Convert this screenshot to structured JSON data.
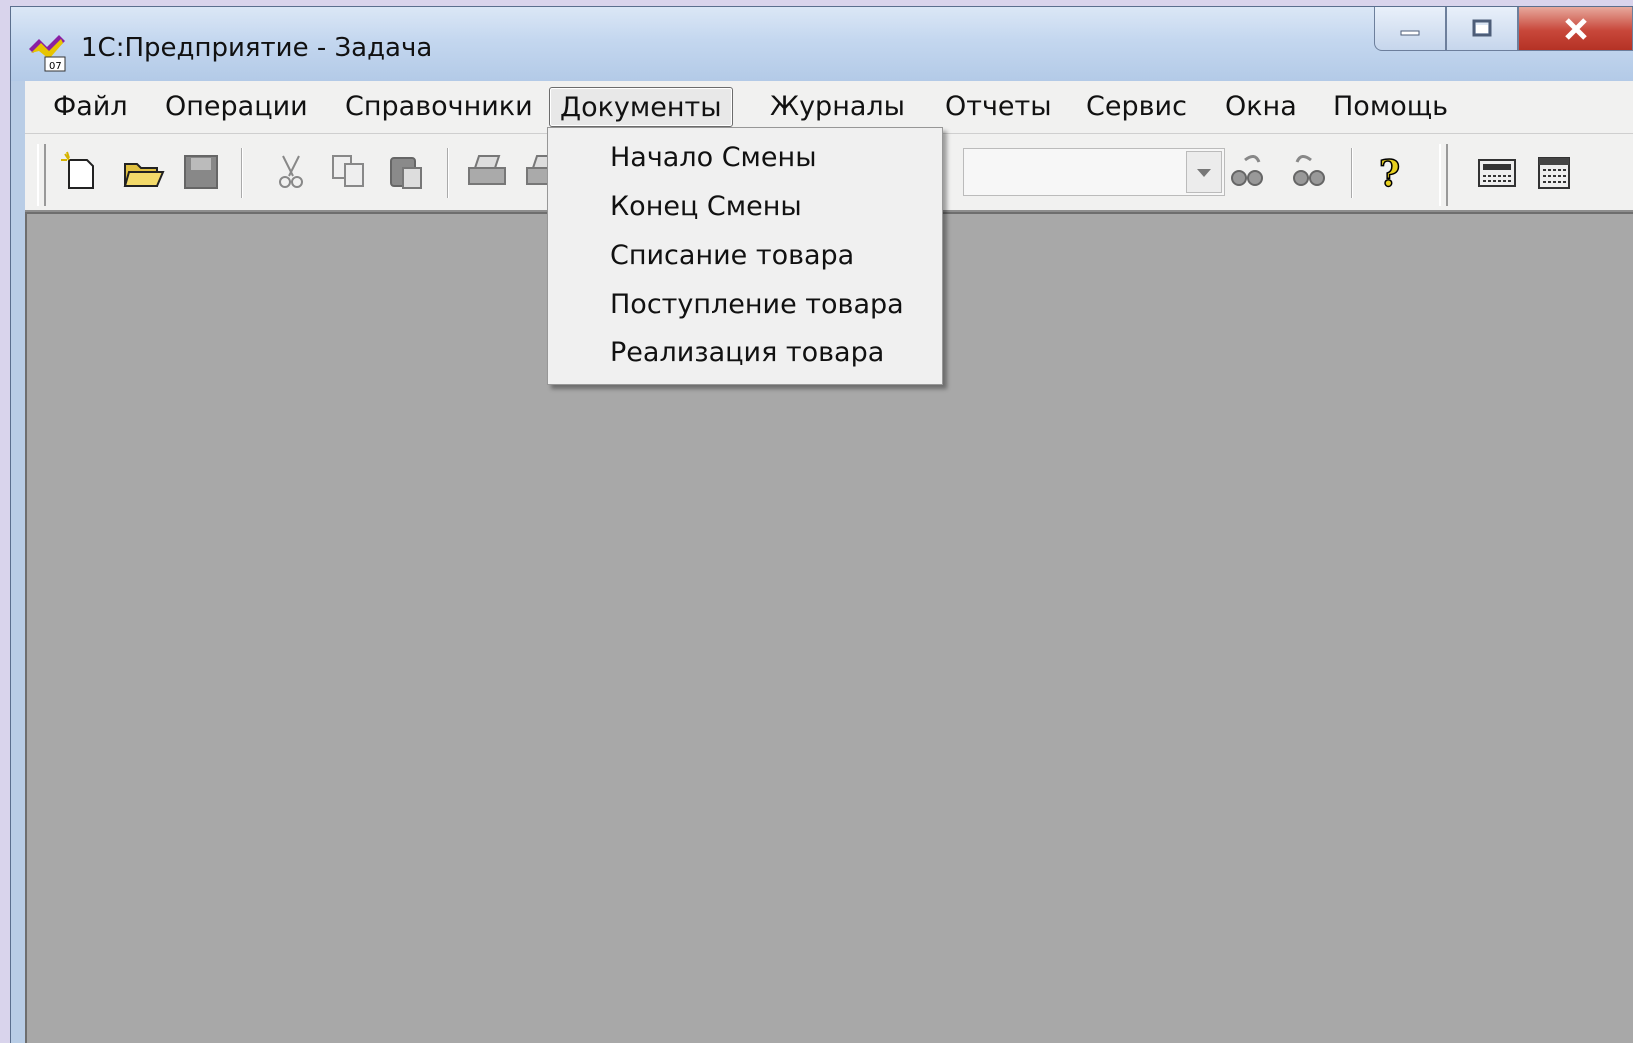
{
  "window": {
    "title": "1С:Предприятие - Задача"
  },
  "menu": {
    "items": [
      "Файл",
      "Операции",
      "Справочники",
      "Документы",
      "Журналы",
      "Отчеты",
      "Сервис",
      "Окна",
      "Помощь"
    ],
    "open_item": "Документы"
  },
  "dropdown": {
    "items": [
      "Начало Смены",
      "Конец Смены",
      "Списание товара",
      "Поступление товара",
      "Реализация товара"
    ]
  },
  "toolbar": {
    "icons": [
      "new-document-icon",
      "open-folder-icon",
      "save-icon",
      "cut-icon",
      "copy-icon",
      "paste-icon",
      "print-icon",
      "print-preview-icon",
      "find-next-icon",
      "find-previous-icon",
      "help-icon",
      "calculator-icon",
      "calendar-icon"
    ],
    "search_combo_value": ""
  },
  "colors": {
    "workspace": "#a8a8a8",
    "menubar": "#f1f1f0",
    "titlebar": "#c4d7ef",
    "close_button": "#c8473a"
  }
}
